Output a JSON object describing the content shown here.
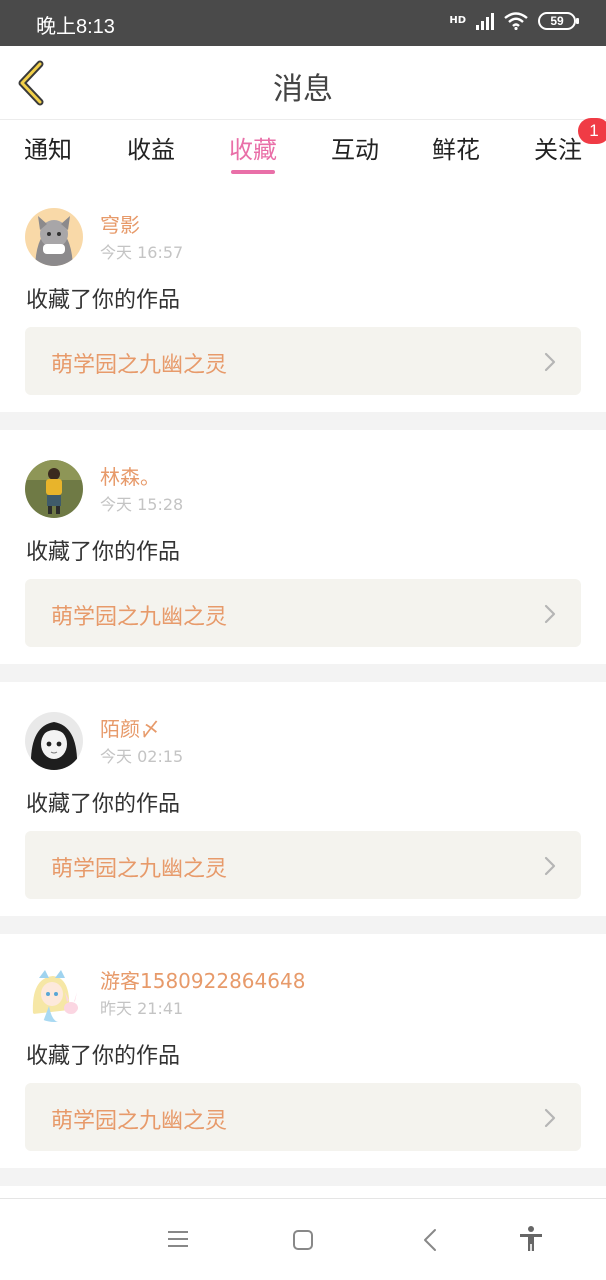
{
  "status_bar": {
    "time": "晚上8:13",
    "network_label": "HD",
    "battery": "59",
    "icons": [
      "signal-icon",
      "wifi-icon",
      "battery-icon"
    ]
  },
  "header": {
    "title": "消息",
    "back_icon": "chevron-left-icon"
  },
  "tabs": [
    {
      "label": "通知"
    },
    {
      "label": "收益"
    },
    {
      "label": "收藏",
      "active": true
    },
    {
      "label": "互动"
    },
    {
      "label": "鲜花"
    },
    {
      "label": "关注",
      "badge": "1"
    }
  ],
  "messages": [
    {
      "user": "穹影",
      "time": "今天 16:57",
      "action": "收藏了你的作品",
      "work": "萌学园之九幽之灵"
    },
    {
      "user": "林森。",
      "time": "今天 15:28",
      "action": "收藏了你的作品",
      "work": "萌学园之九幽之灵"
    },
    {
      "user": "陌颜〆",
      "time": "今天 02:15",
      "action": "收藏了你的作品",
      "work": "萌学园之九幽之灵"
    },
    {
      "user": "游客1580922864648",
      "time": "昨天 21:41",
      "action": "收藏了你的作品",
      "work": "萌学园之九幽之灵"
    }
  ],
  "colors": {
    "accent": "#e96fa8",
    "username": "#e79a6a",
    "badge": "#f03b45",
    "work_bg": "#f4f3ee"
  },
  "nav_bar": {
    "icons": [
      "menu-icon",
      "home-icon",
      "back-icon",
      "accessibility-icon"
    ]
  }
}
